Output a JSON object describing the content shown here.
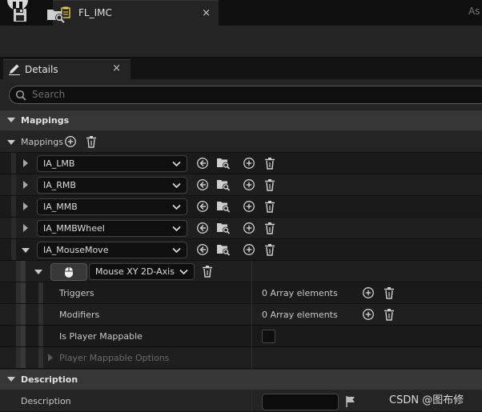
{
  "document_tab": {
    "title": "FL_IMC",
    "close": "×"
  },
  "right_cut_text": "As",
  "details_tab": {
    "label": "Details",
    "close": "×"
  },
  "search": {
    "placeholder": "Search"
  },
  "sections": {
    "mappings_header": "Mappings",
    "mappings_array_label": "Mappings",
    "description_header": "Description"
  },
  "mappings": [
    {
      "action": "IA_LMB",
      "expanded": false
    },
    {
      "action": "IA_RMB",
      "expanded": false
    },
    {
      "action": "IA_MMB",
      "expanded": false
    },
    {
      "action": "IA_MMBWheel",
      "expanded": false
    },
    {
      "action": "IA_MouseMove",
      "expanded": true
    }
  ],
  "key_binding": {
    "key": "Mouse XY 2D-Axis"
  },
  "properties": {
    "triggers_label": "Triggers",
    "triggers_value": "0 Array elements",
    "modifiers_label": "Modifiers",
    "modifiers_value": "0 Array elements",
    "player_mappable_label": "Is Player Mappable",
    "player_mappable_checked": false,
    "player_mappable_options_label": "Player Mappable Options"
  },
  "description": {
    "label": "Description",
    "value": ""
  },
  "watermark": "CSDN @图布修",
  "colors": {
    "panel": "#242424",
    "header": "#363636",
    "field": "#0f0f0f",
    "text": "#c8c8c8"
  }
}
